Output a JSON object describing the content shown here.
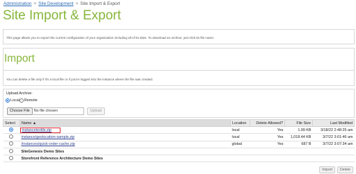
{
  "breadcrumb": {
    "items": [
      "Administration",
      "Site Development",
      "Site Import & Export"
    ],
    "separator": ">"
  },
  "page_title": "Site Import & Export",
  "intro": "This page allows you to export the current configuration of your organization including all of its sites. To download an archive, just click its file name.",
  "import_section": {
    "title": "Import",
    "description": "You can delete a file only if it's a local file or if you're logged into the instance where the file was created."
  },
  "upload": {
    "label": "Upload Archive:",
    "radio_local": "Local",
    "radio_remote": "Remote",
    "choose_button": "Choose File",
    "file_name": "No file chosen",
    "upload_button": "Upload"
  },
  "table": {
    "headers": {
      "select": "Select",
      "name": "Name ▲",
      "location": "Location",
      "delete": "Delete Allowed?",
      "size": "File Size",
      "modified": "Last Modified"
    },
    "rows": [
      {
        "name": "instancetextile.zip",
        "location": "local",
        "delete": "Yes",
        "size": "1.99 KB",
        "modified": "3/18/22 2:48:25 am"
      },
      {
        "name": "instance/geolocation-sample.zip",
        "location": "local",
        "delete": "Yes",
        "size": "1,018.44 KB",
        "modified": "3/7/22 3:01:46 am"
      },
      {
        "name": "/instances/quick-order-cache.zip",
        "location": "global",
        "delete": "Yes",
        "size": "687 B",
        "modified": "3/7/22 3:07:34 am"
      }
    ],
    "groups": [
      "SiteGenesis Demo Sites",
      "Storefront Reference Architecture Demo Sites"
    ]
  },
  "actions": {
    "import": "Import",
    "delete": "Delete"
  },
  "colors": {
    "title_green": "#86b63a",
    "link_blue": "#2a3f8f",
    "highlight_red": "#d8232a"
  }
}
